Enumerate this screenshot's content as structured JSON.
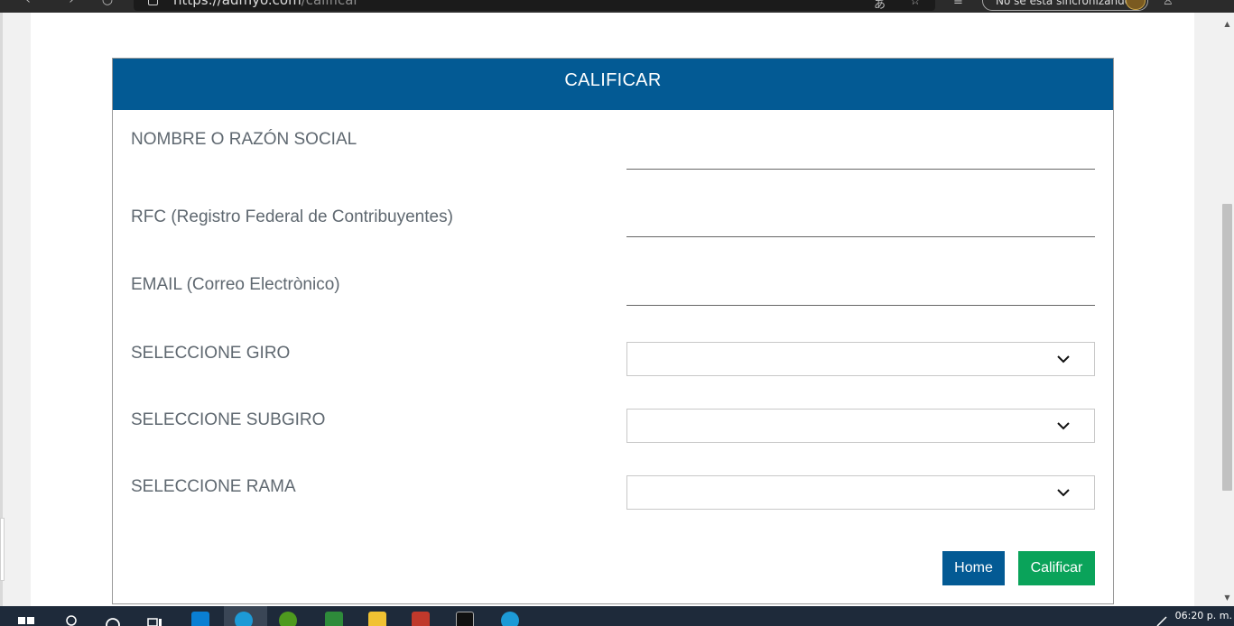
{
  "browser": {
    "url_host": "https://admyo.com",
    "url_path": "/calificar",
    "sync_status": "No se está sincronizando"
  },
  "form": {
    "title": "CALIFICAR",
    "fields": {
      "name_label": "NOMBRE O RAZÓN SOCIAL",
      "rfc_label": "RFC (Registro Federal de Contribuyentes)",
      "email_label": "EMAIL (Correo Electrònico)",
      "giro_label": "SELECCIONE GIRO",
      "subgiro_label": "SELECCIONE SUBGIRO",
      "rama_label": "SELECCIONE RAMA"
    },
    "buttons": {
      "home": "Home",
      "calificar": "Calificar"
    },
    "colors": {
      "header": "#035a94",
      "home_button": "#035a94",
      "calificar_button": "#0aa35a"
    }
  },
  "taskbar": {
    "clock": "06:20 p. m.",
    "icons": [
      "windows-start-icon",
      "search-icon",
      "cortana-icon",
      "task-view-icon",
      "vscode-icon",
      "edge-icon",
      "hs-app-icon",
      "green-app-icon",
      "file-explorer-icon",
      "media-app-icon",
      "terminal-icon",
      "edge-icon"
    ]
  }
}
